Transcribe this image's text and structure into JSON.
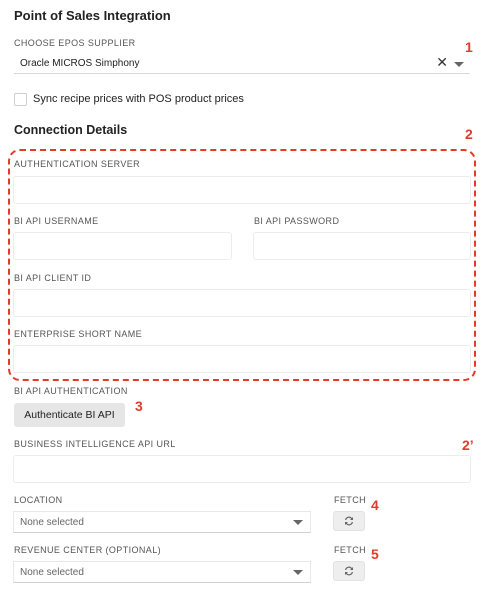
{
  "page": {
    "title": "Point of Sales Integration"
  },
  "supplier": {
    "label": "CHOOSE EPOS SUPPLIER",
    "value": "Oracle MICROS Simphony",
    "clear_icon": "close-icon",
    "dropdown_icon": "caret-down-icon"
  },
  "sync": {
    "label": "Sync recipe prices with POS product prices",
    "checked": false
  },
  "connection": {
    "title": "Connection Details",
    "auth_server_label": "AUTHENTICATION SERVER",
    "username_label": "BI API USERNAME",
    "password_label": "BI API PASSWORD",
    "client_id_label": "BI API CLIENT ID",
    "enterprise_label": "ENTERPRISE SHORT NAME"
  },
  "auth": {
    "label": "BI API AUTHENTICATION",
    "button_label": "Authenticate BI API"
  },
  "bi_url": {
    "label": "BUSINESS INTELLIGENCE API URL"
  },
  "location": {
    "label": "LOCATION",
    "value": "None selected",
    "fetch_label": "FETCH"
  },
  "revenue_center": {
    "label": "REVENUE CENTER (OPTIONAL)",
    "value": "None selected",
    "fetch_label": "FETCH"
  },
  "annotations": {
    "a1": "1",
    "a2": "2",
    "a3": "3",
    "a2b": "2’",
    "a4": "4",
    "a5": "5"
  },
  "colors": {
    "annotation": "#e23b2a",
    "button_bg": "#e6e6e6"
  }
}
